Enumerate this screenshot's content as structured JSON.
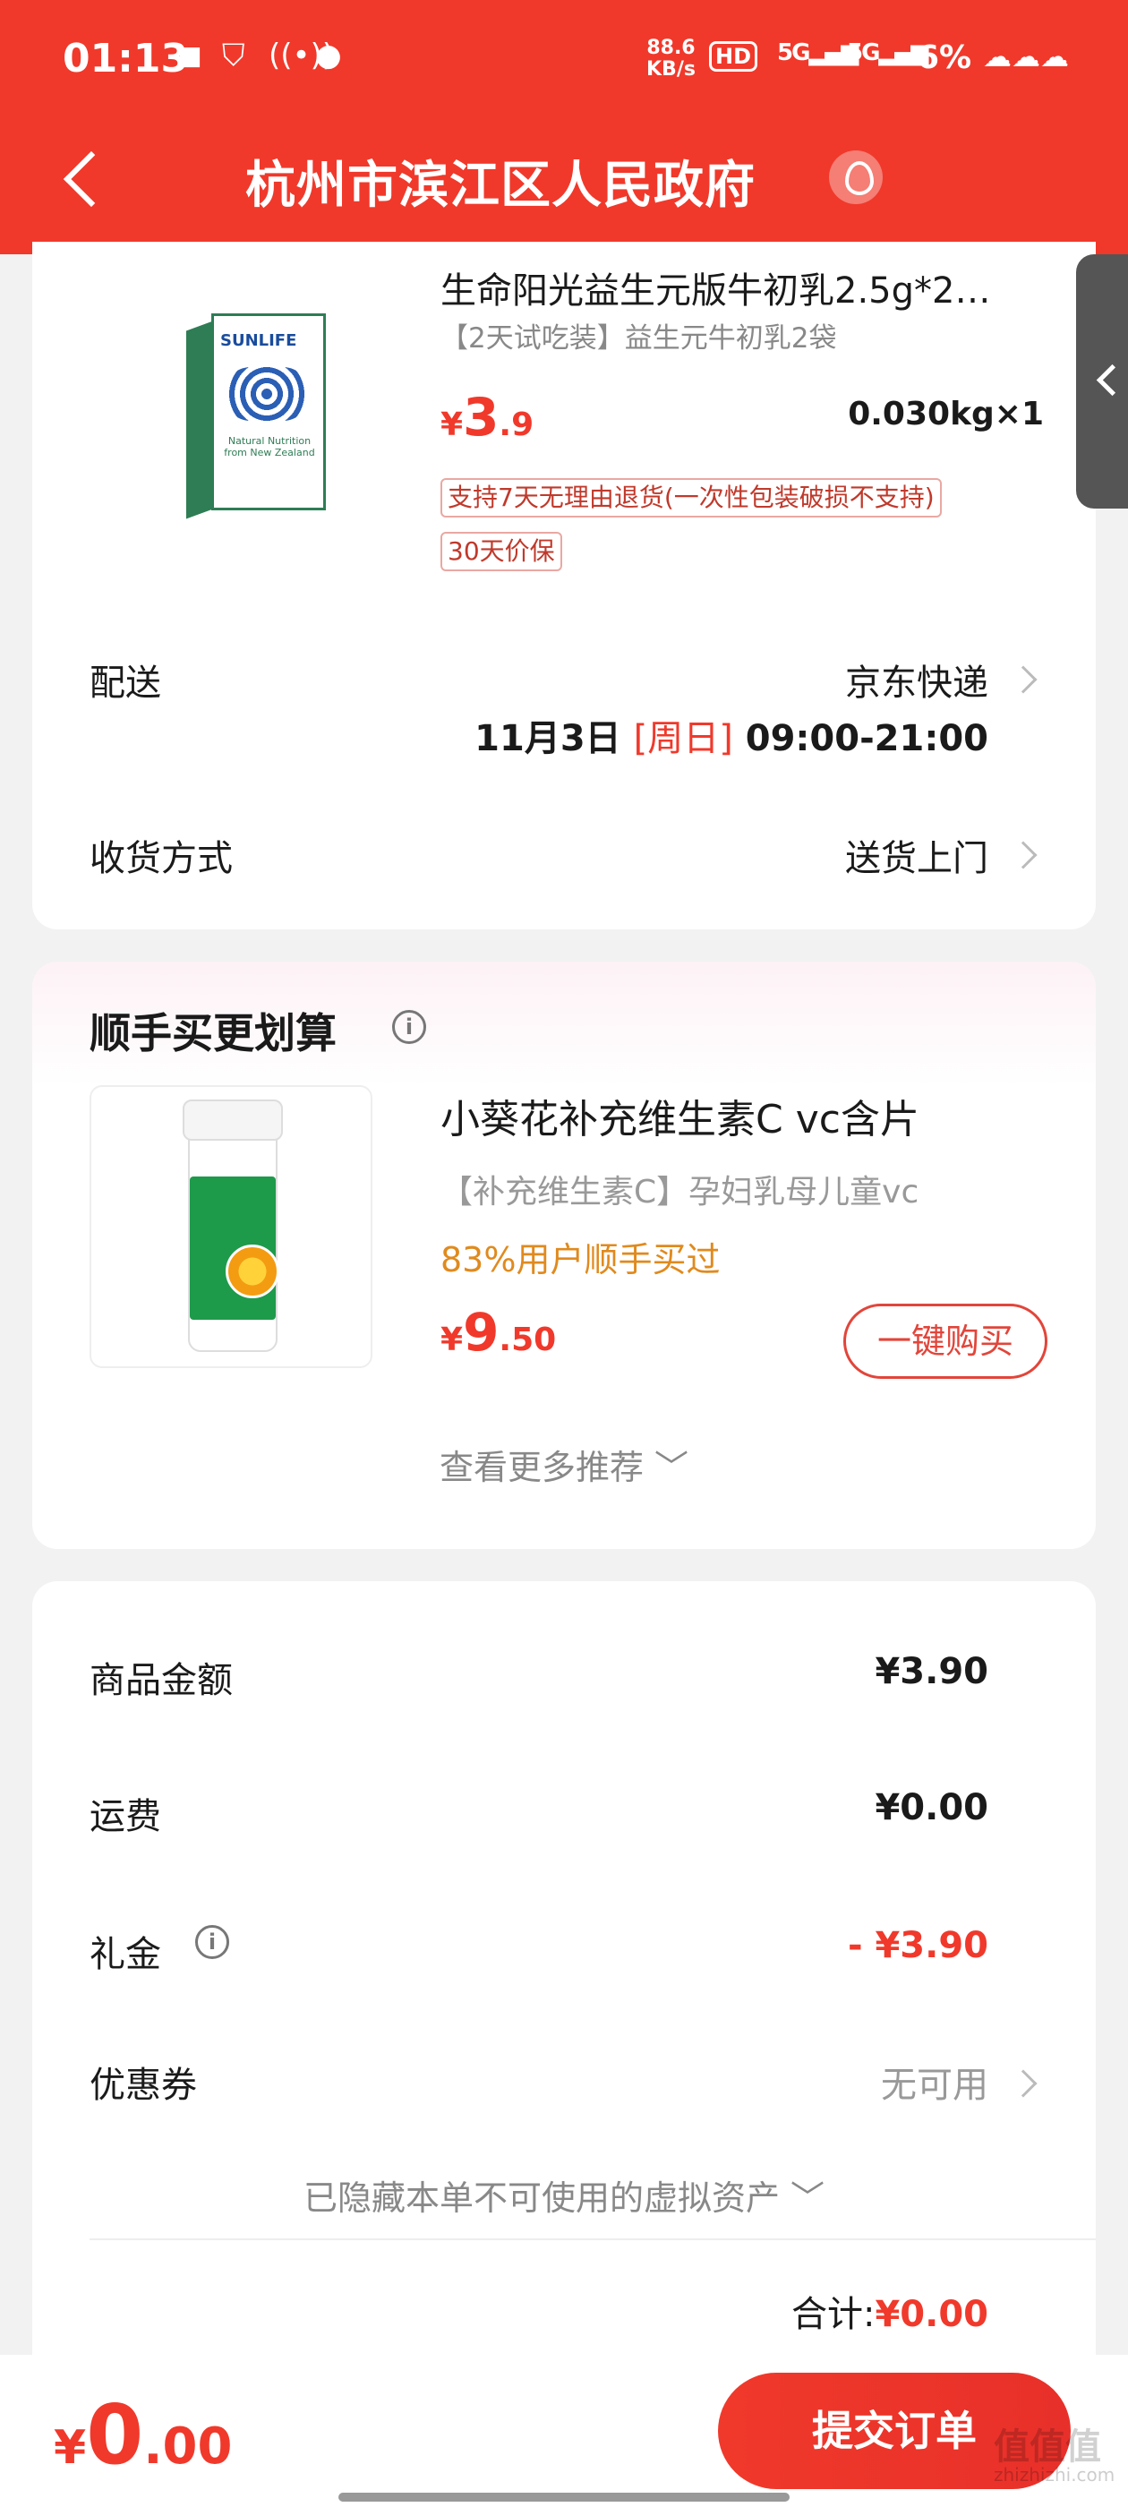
{
  "status_bar": {
    "time": "01:13",
    "net_speed_top": "88.6",
    "net_speed_unit": "KB/s",
    "hd": "HD",
    "signal1": "5G",
    "signal2": "5G",
    "battery": "6%"
  },
  "header": {
    "title": "杭州市滨江区人民政府"
  },
  "product": {
    "title": "生命阳光益生元版牛初乳2.5g*2…",
    "subtitle": "【2天试吃装】益生元牛初乳2袋",
    "price_currency": "¥",
    "price_int": "3",
    "price_dec": ".9",
    "weight_qty": "0.030kg×1",
    "tag_return": "支持7天无理由退货(一次性包装破损不支持)",
    "tag_price_protect": "30天价保",
    "image_brand": "SUNLIFE",
    "image_caption": "Natural Nutrition from New Zealand"
  },
  "delivery": {
    "label": "配送",
    "value": "京东快递",
    "date": "11月3日",
    "day": "[周日]",
    "time_window": "09:00-21:00"
  },
  "receive": {
    "label": "收货方式",
    "value": "送货上门"
  },
  "recommend": {
    "title": "顺手买更划算",
    "item_name": "小葵花补充维生素C vc含片",
    "item_subtitle": "【补充维生素C】孕妇乳母儿童vc",
    "item_popularity": "83%用户顺手买过",
    "price_currency": "¥",
    "price_int": "9",
    "price_dec": ".50",
    "buy_label": "一键购买",
    "more_label": "查看更多推荐 ﹀"
  },
  "totals": {
    "goods_label": "商品金额",
    "goods_value": "¥3.90",
    "shipping_label": "运费",
    "shipping_value": "¥0.00",
    "gift_label": "礼金",
    "gift_value": "- ¥3.90",
    "coupon_label": "优惠券",
    "coupon_value": "无可用",
    "hidden_assets": "已隐藏本单不可使用的虚拟资产 ﹀",
    "sum_label": "合计:",
    "sum_value": "¥0.00"
  },
  "bottom_bar": {
    "currency": "¥",
    "total_int": "0",
    "total_dec": ".00",
    "submit_label": "提交订单"
  },
  "watermark": {
    "text": "值值值",
    "sub": "zhizhizhi.com"
  },
  "colors": {
    "brand_red": "#f0392b",
    "orange_text": "#e08a1e"
  }
}
